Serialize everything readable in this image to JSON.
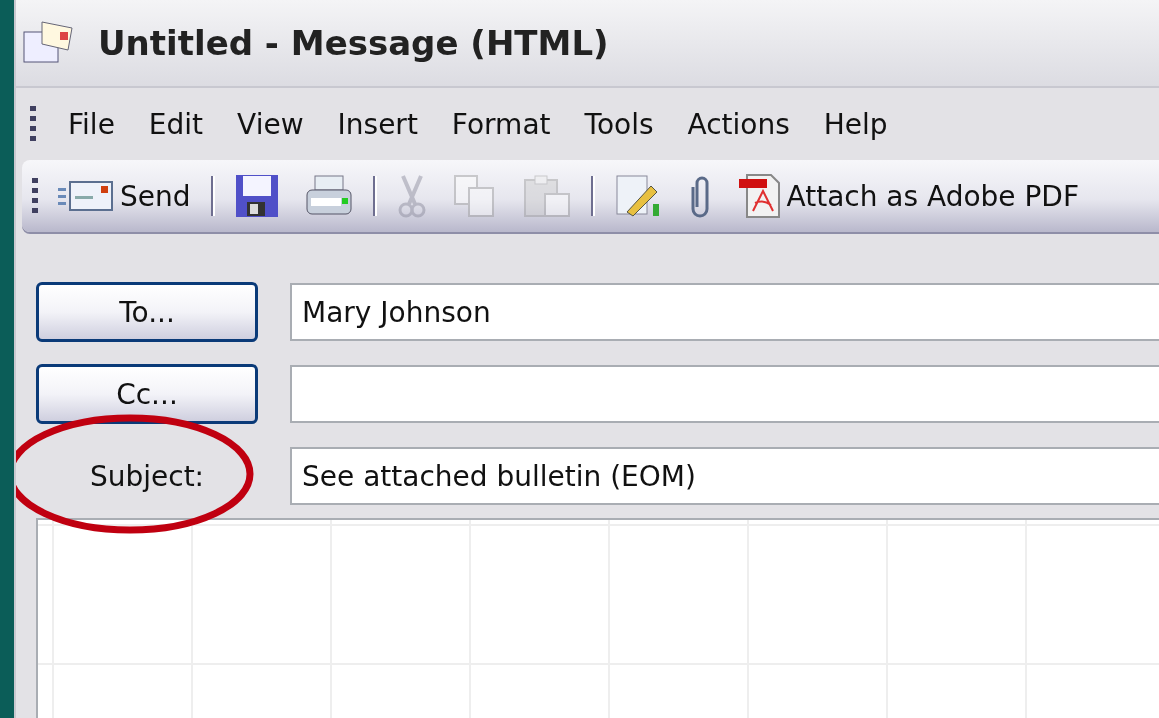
{
  "window": {
    "title": "Untitled - Message (HTML)"
  },
  "menu": [
    "File",
    "Edit",
    "View",
    "Insert",
    "Format",
    "Tools",
    "Actions",
    "Help"
  ],
  "toolbar": [
    {
      "kind": "button",
      "label": "Send",
      "disabled": false
    },
    {
      "kind": "separator"
    },
    {
      "kind": "button",
      "disabled": false
    },
    {
      "kind": "button",
      "disabled": false
    },
    {
      "kind": "separator"
    },
    {
      "kind": "button",
      "disabled": true
    },
    {
      "kind": "button",
      "disabled": true
    },
    {
      "kind": "button",
      "disabled": true
    },
    {
      "kind": "separator"
    },
    {
      "kind": "button",
      "disabled": false
    },
    {
      "kind": "button",
      "disabled": false
    },
    {
      "kind": "button",
      "label": "Attach as Adobe PDF",
      "disabled": false
    }
  ],
  "fields": [
    {
      "kind": "button",
      "label": "To...",
      "value": "Mary Johnson"
    },
    {
      "kind": "button",
      "label": "Cc..."
    },
    {
      "kind": "label",
      "label": "Subject:",
      "value": "See attached bulletin (EOM)"
    }
  ],
  "annotation": {
    "kind": "ellipse"
  }
}
